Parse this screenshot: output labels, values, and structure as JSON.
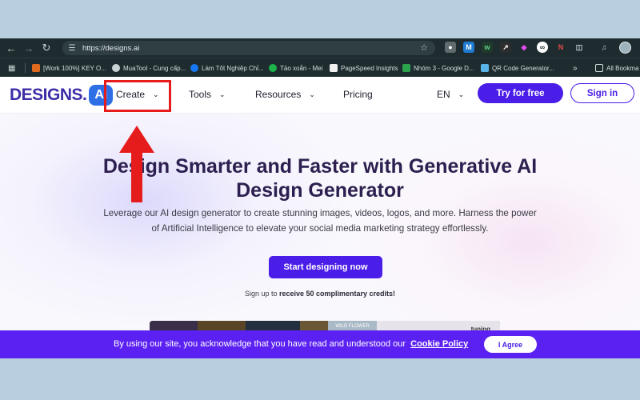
{
  "browser": {
    "url": "https://designs.ai",
    "bookmarks": [
      {
        "label": "[Work 100%] KEY O...",
        "color": "#e06b1f"
      },
      {
        "label": "MuaTool - Cung cấp...",
        "color": "#c9d3d6"
      },
      {
        "label": "Làm Tốt Nghiệp Chỉ...",
        "color": "#1877f2"
      },
      {
        "label": "Tảo xoắn - Mei",
        "color": "#1bb34a"
      },
      {
        "label": "PageSpeed Insights",
        "color": "#f0f0f0"
      },
      {
        "label": "Nhóm 3 - Google D...",
        "color": "#2ba24c"
      },
      {
        "label": "QR Code Generator...",
        "color": "#5ab3e6"
      }
    ],
    "all_bookmarks": "All Bookma",
    "more": "»"
  },
  "site": {
    "logo_text": "DESIGNS.",
    "logo_badge": "Ai",
    "nav": [
      {
        "label": "Create",
        "has_dropdown": true
      },
      {
        "label": "Tools",
        "has_dropdown": true
      },
      {
        "label": "Resources",
        "has_dropdown": true
      },
      {
        "label": "Pricing",
        "has_dropdown": false
      }
    ],
    "language": "EN",
    "try_label": "Try for free",
    "signin_label": "Sign in",
    "accent_color": "#4a1de8"
  },
  "hero": {
    "title_line1": "Design Smarter and Faster with Generative AI",
    "title_line2": "Design Generator",
    "subtitle_line1": "Leverage our AI design generator to create stunning images, videos, logos, and more. Harness the power",
    "subtitle_line2": "of Artificial Intelligence to elevate your social media marketing strategy effortlessly.",
    "cta_label": "Start designing now",
    "signup_prefix": "Sign up to ",
    "signup_bold": "receive 50 complimentary credits!",
    "preview_tiles": [
      "WILD FLOWER",
      "tuning"
    ]
  },
  "cookie": {
    "text": "By using our site, you acknowledge that you have read and understood our",
    "link": "Cookie Policy",
    "button": "I Agree"
  }
}
